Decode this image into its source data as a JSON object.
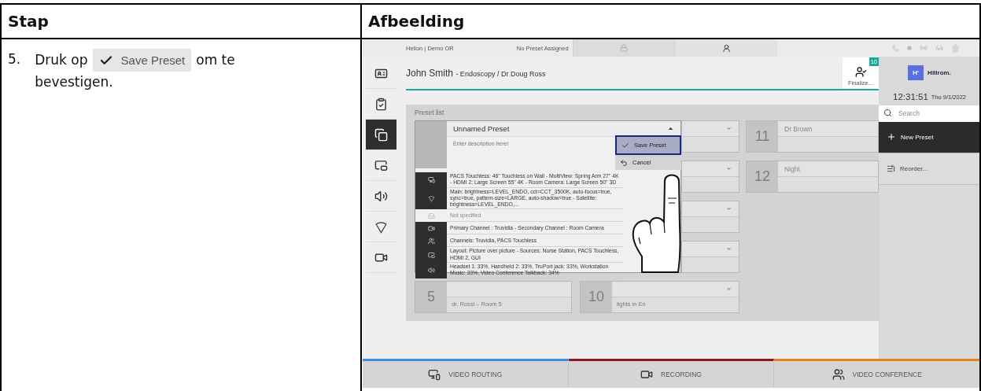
{
  "table_header": [
    "Stap",
    "Afbeelding"
  ],
  "step": {
    "number": "5.",
    "text_before": "Druk op",
    "button_label": "Save Preset",
    "text_after": "om te bevestigen."
  },
  "app": {
    "status_bar": {
      "location": "Helion | Demo OR",
      "preset": "No Preset Assigned"
    },
    "sidebar": [
      {
        "kind": "id-card",
        "selected": false
      },
      {
        "kind": "checklist",
        "selected": false
      },
      {
        "kind": "presets",
        "selected": true
      },
      {
        "kind": "screens",
        "selected": false
      },
      {
        "kind": "audio",
        "selected": false
      },
      {
        "kind": "light",
        "selected": false
      },
      {
        "kind": "camera",
        "selected": false
      }
    ],
    "patient": {
      "name": "John Smith",
      "detail": "- Endoscopy / Dr Doug Ross"
    },
    "finalize": {
      "label": "Finalize...",
      "badge": "10"
    },
    "brand": {
      "mark": "H'",
      "name": "Hillrom."
    },
    "clock": {
      "time": "12:31:51",
      "date": "Thu 9/1/2022"
    },
    "search": {
      "placeholder": "Search"
    },
    "actions": [
      {
        "kind": "primary",
        "label": "New Preset"
      },
      {
        "kind": "secondary",
        "label": "Reorder..."
      }
    ],
    "preset_list": {
      "title": "Preset list",
      "editor": {
        "name": "Unnamed Preset",
        "description_placeholder": "Enter description here!",
        "menu": [
          {
            "kind": "save",
            "label": "Save Preset",
            "selected": true
          },
          {
            "kind": "cancel",
            "label": "Cancel",
            "selected": false
          }
        ],
        "details": [
          {
            "kind": "displays",
            "disabled": false,
            "text": "PACS Touchless: 46\" Touchless on Wall - MultiView: Spring Arm 27\" 4K - HDMI 2: Large Screen 55\" 4K - Room Camera: Large Screen 50\" 3D"
          },
          {
            "kind": "light",
            "disabled": false,
            "text": "Main: brightness=LEVEL_ENDO, cct=CCT_3500K, auto-focus=true, sync=true, pattern-size=LARGE, auto-shadow=true - Satellite: brightness=LEVEL_ENDO,..."
          },
          {
            "kind": "tray",
            "disabled": true,
            "text": "Not specified"
          },
          {
            "kind": "recording",
            "disabled": false,
            "text": "Primary Channel : Truvidia - Secondary Channel : Room Camera"
          },
          {
            "kind": "conference",
            "disabled": false,
            "text": "Channels: Truvidia, PACS Touchless"
          },
          {
            "kind": "layout",
            "disabled": false,
            "text": "Layout: Picture over picture - Sources: Nurse Station, PACS Touchless, HDMI 2, GUI"
          },
          {
            "kind": "audio",
            "disabled": false,
            "text": "Headset 1: 33%, Handheld 2: 33%, TruPort jack: 33%, Workstation Music: 33%, Video Conference Talkback: 34%"
          }
        ]
      },
      "side_cards": [
        {
          "has_menu": true
        },
        {
          "has_menu": true
        },
        {
          "has_menu": true
        },
        {
          "has_menu": true
        }
      ],
      "right_cards": [
        {
          "number": "11",
          "name": "Dr Brown",
          "has_menu": false
        },
        {
          "number": "12",
          "name": "Night",
          "has_menu": false
        }
      ],
      "bottom_cards": [
        {
          "number": "5",
          "name": "dr. Rossi – Room 5",
          "has_menu": false
        },
        {
          "number": "10",
          "name": "lights in En",
          "has_menu": true
        }
      ]
    },
    "bottom_tabs": [
      {
        "kind": "routing",
        "label": "VIDEO ROUTING",
        "color": "#3d8fe0"
      },
      {
        "kind": "recording",
        "label": "RECORDING",
        "color": "#8a1c1c"
      },
      {
        "kind": "conference",
        "label": "VIDEO CONFERENCE",
        "color": "#e8821e"
      }
    ]
  }
}
